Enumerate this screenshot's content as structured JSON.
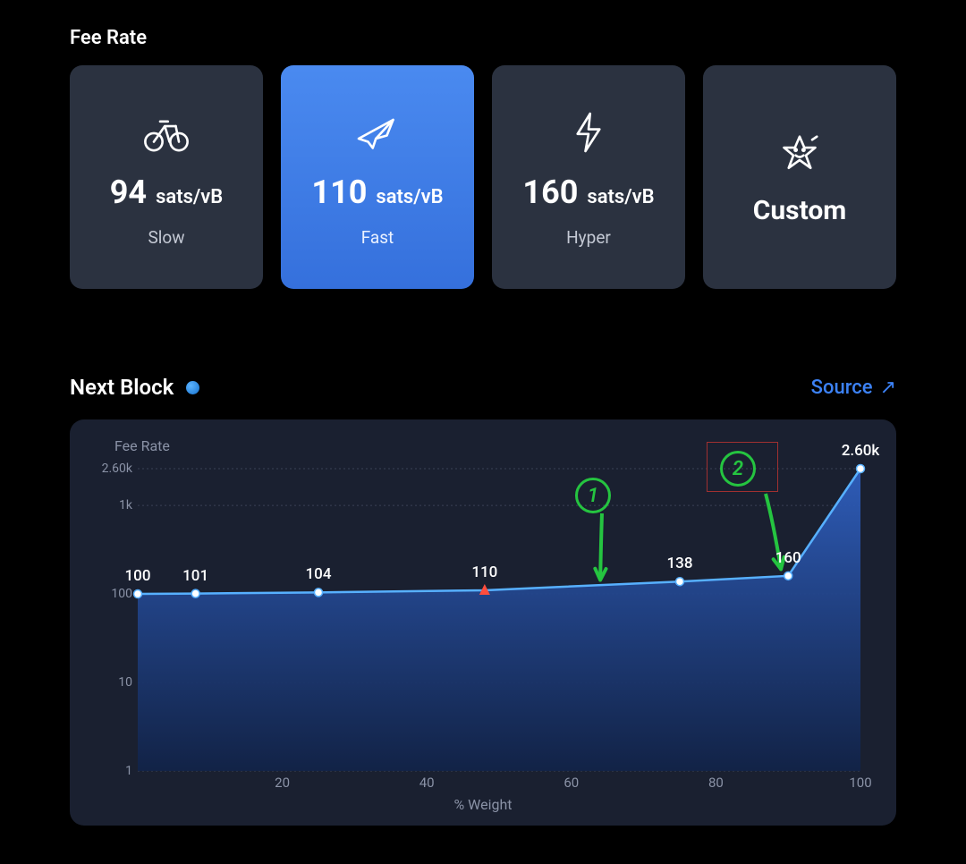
{
  "section_title": "Fee Rate",
  "fee_cards": [
    {
      "icon": "bike-icon",
      "value": "94",
      "unit": "sats/vB",
      "label": "Slow",
      "selected": false
    },
    {
      "icon": "plane-icon",
      "value": "110",
      "unit": "sats/vB",
      "label": "Fast",
      "selected": true
    },
    {
      "icon": "bolt-icon",
      "value": "160",
      "unit": "sats/vB",
      "label": "Hyper",
      "selected": false
    },
    {
      "icon": "star-icon",
      "custom_label": "Custom",
      "selected": false
    }
  ],
  "next_block": {
    "title": "Next Block",
    "source_label": "Source",
    "source_arrow": "↗"
  },
  "chart_data": {
    "type": "area",
    "title": "",
    "ylabel_small": "Fee Rate",
    "xlabel": "% Weight",
    "y_scale": "log",
    "ylim": [
      1,
      2600
    ],
    "xlim": [
      0,
      100
    ],
    "y_ticks": [
      {
        "v": 1,
        "label": "1"
      },
      {
        "v": 10,
        "label": "10"
      },
      {
        "v": 100,
        "label": "100"
      },
      {
        "v": 1000,
        "label": "1k"
      },
      {
        "v": 2600,
        "label": "2.60k"
      }
    ],
    "x_ticks": [
      20,
      40,
      60,
      80,
      100
    ],
    "series": [
      {
        "name": "fee_by_weight",
        "points_labeled": [
          {
            "x": 0,
            "y": 100,
            "label": "100"
          },
          {
            "x": 8,
            "y": 101,
            "label": "101"
          },
          {
            "x": 25,
            "y": 104,
            "label": "104"
          },
          {
            "x": 48,
            "y": 110,
            "label": "110",
            "marker": "triangle"
          },
          {
            "x": 75,
            "y": 138,
            "label": "138"
          },
          {
            "x": 90,
            "y": 160,
            "label": "160"
          },
          {
            "x": 100,
            "y": 2600,
            "label": "2.60k"
          }
        ]
      }
    ],
    "annotations": [
      {
        "id": "1",
        "type": "circled_number",
        "arrow_to_x": 62,
        "arrow_to_y": 125
      },
      {
        "id": "2",
        "type": "circled_number",
        "arrow_to_x": 89,
        "arrow_to_y": 158,
        "boxed": true
      }
    ],
    "colors": {
      "line": "#57b0ff",
      "fill_top": "#2f5fbf",
      "fill_bottom": "#112349",
      "marker": "#ffffff",
      "triangle": "#ff4d3d"
    }
  }
}
